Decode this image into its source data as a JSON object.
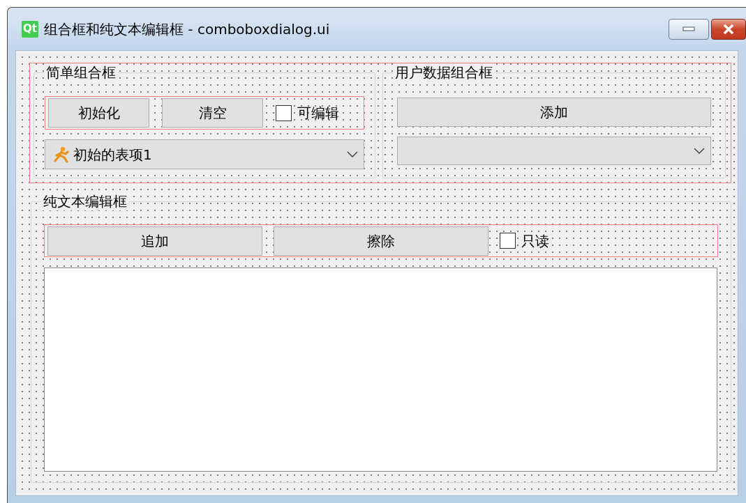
{
  "window": {
    "logo": "Qt",
    "title": "组合框和纯文本编辑框 - comboboxdialog.ui"
  },
  "simple_group": {
    "title": "简单组合框",
    "buttons": [
      "初始化",
      "清空"
    ],
    "checkbox": {
      "label": "可编辑",
      "checked": false
    },
    "combo": {
      "value": "初始的表项1"
    }
  },
  "user_data_group": {
    "title": "用户数据组合框",
    "button": "添加"
  },
  "plain_text_group": {
    "title": "纯文本编辑框",
    "buttons": [
      "追加",
      "擦除"
    ],
    "checkbox": {
      "label": "只读",
      "checked": false
    }
  }
}
